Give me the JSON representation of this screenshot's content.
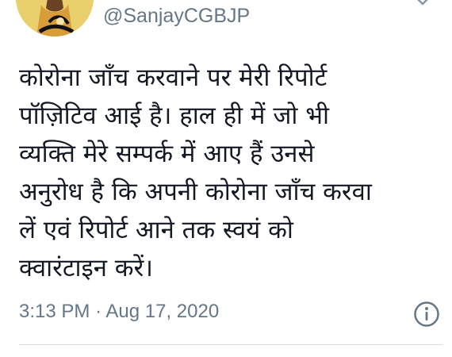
{
  "tweet": {
    "handle": "@SanjayCGBJP",
    "text_lines": [
      "कोरोना जाँच करवाने पर मेरी रिपोर्ट",
      "पॉज़िटिव आई है। हाल ही में जो भी",
      "व्यक्ति मेरे सम्पर्क में आए हैं उनसे",
      "अनुरोध है कि अपनी कोरोना जाँच करवा",
      "लें एवं रिपोर्ट आने तक स्वयं को",
      "क्वारंटाइन करें।"
    ],
    "time": "3:13 PM",
    "separator": "·",
    "date": "Aug 17, 2020"
  },
  "icons": {
    "avatar": "profile-avatar",
    "menu": "chevron-down-icon",
    "info": "info-icon"
  },
  "colors": {
    "text": "#141823",
    "secondary": "#657786",
    "avatar_bg": "#e9d06d",
    "divider": "#d7dce0"
  }
}
